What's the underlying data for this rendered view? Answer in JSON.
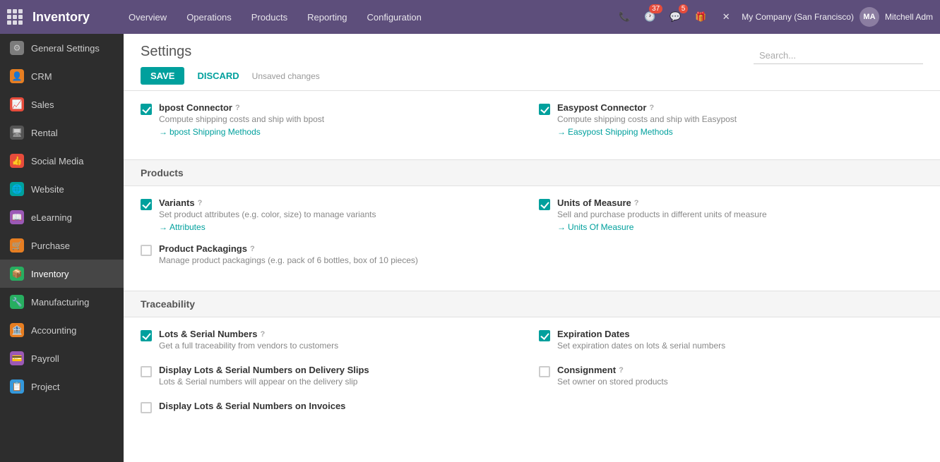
{
  "topnav": {
    "brand": "Inventory",
    "nav_items": [
      "Overview",
      "Operations",
      "Products",
      "Reporting",
      "Configuration"
    ],
    "badge_clock": "37",
    "badge_chat": "5",
    "company": "My Company (San Francisco)",
    "user": "Mitchell Adm"
  },
  "sidebar": {
    "items": [
      {
        "label": "General Settings",
        "icon": "⚙",
        "color": "#7c7c7c",
        "active": false
      },
      {
        "label": "CRM",
        "icon": "👤",
        "color": "#e67e22",
        "active": false
      },
      {
        "label": "Sales",
        "icon": "📈",
        "color": "#e74c3c",
        "active": false
      },
      {
        "label": "Rental",
        "icon": "🖥",
        "color": "#555",
        "active": false
      },
      {
        "label": "Social Media",
        "icon": "👍",
        "color": "#e74c3c",
        "active": false
      },
      {
        "label": "Website",
        "icon": "🌐",
        "color": "#00a09d",
        "active": false
      },
      {
        "label": "eLearning",
        "icon": "📖",
        "color": "#9b59b6",
        "active": false
      },
      {
        "label": "Purchase",
        "icon": "🛒",
        "color": "#e67e22",
        "active": false
      },
      {
        "label": "Inventory",
        "icon": "📦",
        "color": "#27ae60",
        "active": true
      },
      {
        "label": "Manufacturing",
        "icon": "🔧",
        "color": "#27ae60",
        "active": false
      },
      {
        "label": "Accounting",
        "icon": "🏦",
        "color": "#e67e22",
        "active": false
      },
      {
        "label": "Payroll",
        "icon": "💳",
        "color": "#9b59b6",
        "active": false
      },
      {
        "label": "Project",
        "icon": "📋",
        "color": "#3498db",
        "active": false
      }
    ]
  },
  "page": {
    "title": "Settings",
    "save_label": "SAVE",
    "discard_label": "DISCARD",
    "unsaved_label": "Unsaved changes",
    "search_placeholder": "Search..."
  },
  "sections": [
    {
      "id": "shipping",
      "header": "",
      "items": [
        {
          "col": 0,
          "checked": true,
          "label": "bpost Connector",
          "has_help": true,
          "desc": "Compute shipping costs and ship with bpost",
          "link": "bpost Shipping Methods"
        },
        {
          "col": 1,
          "checked": true,
          "label": "Easypost Connector",
          "has_help": true,
          "desc": "Compute shipping costs and ship with Easypost",
          "link": "Easypost Shipping Methods"
        }
      ]
    },
    {
      "id": "products",
      "header": "Products",
      "items": [
        {
          "col": 0,
          "checked": true,
          "label": "Variants",
          "has_help": true,
          "desc": "Set product attributes (e.g. color, size) to manage variants",
          "link": "Attributes"
        },
        {
          "col": 1,
          "checked": true,
          "label": "Units of Measure",
          "has_help": true,
          "desc": "Sell and purchase products in different units of measure",
          "link": "Units Of Measure"
        },
        {
          "col": 0,
          "checked": false,
          "label": "Product Packagings",
          "has_help": true,
          "desc": "Manage product packagings (e.g. pack of 6 bottles, box of 10 pieces)",
          "link": ""
        }
      ]
    },
    {
      "id": "traceability",
      "header": "Traceability",
      "items": [
        {
          "col": 0,
          "checked": true,
          "label": "Lots & Serial Numbers",
          "has_help": true,
          "desc": "Get a full traceability from vendors to customers",
          "link": ""
        },
        {
          "col": 1,
          "checked": true,
          "label": "Expiration Dates",
          "has_help": false,
          "desc": "Set expiration dates on lots & serial numbers",
          "link": ""
        },
        {
          "col": 0,
          "checked": false,
          "label": "Display Lots & Serial Numbers on Delivery Slips",
          "has_help": false,
          "desc": "Lots & Serial numbers will appear on the delivery slip",
          "link": ""
        },
        {
          "col": 1,
          "checked": false,
          "label": "Consignment",
          "has_help": true,
          "desc": "Set owner on stored products",
          "link": ""
        },
        {
          "col": 0,
          "checked": false,
          "label": "Display Lots & Serial Numbers on Invoices",
          "has_help": false,
          "desc": "",
          "link": ""
        }
      ]
    }
  ]
}
